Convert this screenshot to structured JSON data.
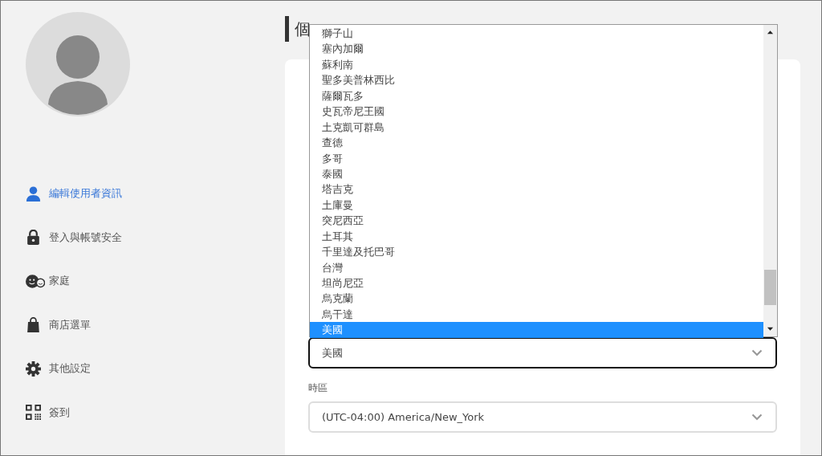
{
  "page_title": "個",
  "sidebar": {
    "items": [
      {
        "label": "編輯使用者資訊",
        "kind": "person",
        "selected": true
      },
      {
        "label": "登入與帳號安全",
        "kind": "lock",
        "selected": false
      },
      {
        "label": "家庭",
        "kind": "faces",
        "selected": false
      },
      {
        "label": "商店選單",
        "kind": "bag",
        "selected": false
      },
      {
        "label": "其他設定",
        "kind": "gear",
        "selected": false
      },
      {
        "label": "簽到",
        "kind": "qr",
        "selected": false
      }
    ]
  },
  "country_dropdown": {
    "options": [
      {
        "label": "獅子山",
        "selected": false
      },
      {
        "label": "塞內加爾",
        "selected": false
      },
      {
        "label": "蘇利南",
        "selected": false
      },
      {
        "label": "聖多美普林西比",
        "selected": false
      },
      {
        "label": "薩爾瓦多",
        "selected": false
      },
      {
        "label": "史瓦帝尼王國",
        "selected": false
      },
      {
        "label": "土克凱可群島",
        "selected": false
      },
      {
        "label": "查德",
        "selected": false
      },
      {
        "label": "多哥",
        "selected": false
      },
      {
        "label": "泰國",
        "selected": false
      },
      {
        "label": "塔吉克",
        "selected": false
      },
      {
        "label": "土庫曼",
        "selected": false
      },
      {
        "label": "突尼西亞",
        "selected": false
      },
      {
        "label": "土耳其",
        "selected": false
      },
      {
        "label": "千里達及托巴哥",
        "selected": false
      },
      {
        "label": "台灣",
        "selected": false
      },
      {
        "label": "坦尚尼亞",
        "selected": false
      },
      {
        "label": "烏克蘭",
        "selected": false
      },
      {
        "label": "烏干達",
        "selected": false
      },
      {
        "label": "美國",
        "selected": true
      }
    ]
  },
  "country_select": {
    "value": "美國"
  },
  "timezone": {
    "label": "時區",
    "value": "(UTC-04:00) America/New_York"
  }
}
